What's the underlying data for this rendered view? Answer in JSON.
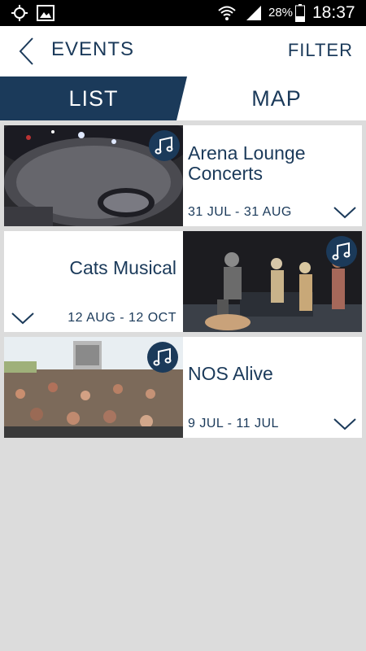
{
  "status_bar": {
    "battery": "28%",
    "time": "18:37"
  },
  "header": {
    "title": "EVENTS",
    "filter_label": "FILTER"
  },
  "tabs": [
    {
      "label": "LIST",
      "active": true
    },
    {
      "label": "MAP",
      "active": false
    }
  ],
  "colors": {
    "primary": "#1b3a5a",
    "background": "#dcdcdc"
  },
  "events": [
    {
      "title_line1": "Arena Lounge",
      "title_line2": "Concerts",
      "date": "31 JUL - 31 AUG",
      "icon": "music-notes-icon"
    },
    {
      "title_line1": "Cats Musical",
      "title_line2": "",
      "date": "12 AUG - 12 OCT",
      "icon": "music-notes-icon"
    },
    {
      "title_line1": "NOS Alive",
      "title_line2": "",
      "date": "9 JUL - 11 JUL",
      "icon": "music-notes-icon"
    }
  ]
}
